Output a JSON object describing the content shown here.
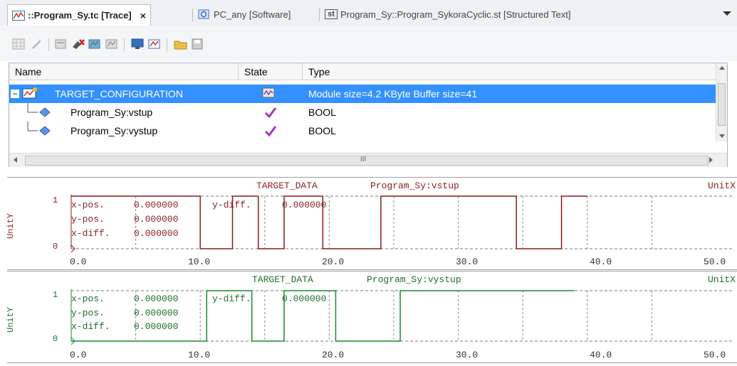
{
  "tabs": [
    {
      "label": "::Program_Sy.tc [Trace]",
      "icon": "trace-icon",
      "close": "×"
    },
    {
      "label": "PC_any [Software]",
      "icon": "software-icon"
    },
    {
      "label": "Program_Sy::Program_SykoraCyclic.st [Structured Text]",
      "icon": "st-icon",
      "badge": "st"
    }
  ],
  "tree": {
    "headers": [
      "Name",
      "State",
      "Type"
    ],
    "rows": [
      {
        "name": "TARGET_CONFIGURATION",
        "type": "Module size=4.2 KByte   Buffer size=41",
        "selected": true,
        "state_icon": "trace-state-icon",
        "expand": "−"
      },
      {
        "name": "Program_Sy:vstup",
        "type": "BOOL",
        "state_icon": "check-icon"
      },
      {
        "name": "Program_Sy:vystup",
        "type": "BOOL",
        "state_icon": "check-icon"
      }
    ],
    "scroll_mid": "III"
  },
  "traces": [
    {
      "source": "TARGET_DATA",
      "variable": "Program_Sy:vstup",
      "unitx": "UnitX",
      "unity": "UnitY",
      "color": "#8b1a1a",
      "xpos_label": "x-pos.",
      "xpos": "0.000000",
      "ypos_label": "y-pos.",
      "ypos": "0.000000",
      "xdiff_label": "x-diff.",
      "xdiff": "0.000000",
      "ydiff_label": "y-diff.",
      "ydiff": "0.000000",
      "y_top": "1",
      "y_bot": "0",
      "ticks": [
        "0.0",
        "10.0",
        "20.0",
        "30.0",
        "40.0",
        "50.0"
      ]
    },
    {
      "source": "TARGET_DATA",
      "variable": "Program_Sy:vystup",
      "unitx": "UnitX",
      "unity": "UnitY",
      "color": "#1a8a2a",
      "xpos_label": "x-pos.",
      "xpos": "0.000000",
      "ypos_label": "y-pos.",
      "ypos": "0.000000",
      "xdiff_label": "x-diff.",
      "xdiff": "0.000000",
      "ydiff_label": "y-diff.",
      "ydiff": "0.000000",
      "y_top": "1",
      "y_bot": "0",
      "ticks": [
        "0.0",
        "10.0",
        "20.0",
        "30.0",
        "40.0",
        "50.0"
      ]
    }
  ],
  "chart_data": [
    {
      "type": "line",
      "title": "TARGET_DATA  Program_Sy:vstup",
      "xlabel": "UnitX",
      "ylabel": "UnitY",
      "xlim": [
        0,
        50
      ],
      "ylim": [
        0,
        1
      ],
      "series": [
        {
          "name": "Program_Sy:vstup",
          "x": [
            0,
            10,
            10,
            12.5,
            12.5,
            14.5,
            14.5,
            16.5,
            16.5,
            19.5,
            19.5,
            24,
            24,
            34.5,
            34.5,
            38,
            38,
            40
          ],
          "y": [
            1,
            1,
            0,
            0,
            1,
            1,
            0,
            0,
            1,
            1,
            0,
            0,
            1,
            1,
            0,
            0,
            1,
            1
          ]
        }
      ]
    },
    {
      "type": "line",
      "title": "TARGET_DATA  Program_Sy:vystup",
      "xlabel": "UnitX",
      "ylabel": "UnitY",
      "xlim": [
        0,
        50
      ],
      "ylim": [
        0,
        1
      ],
      "series": [
        {
          "name": "Program_Sy:vystup",
          "x": [
            0,
            10.5,
            10.5,
            14,
            14,
            16.5,
            16.5,
            20.5,
            20.5,
            25.5,
            25.5,
            39
          ],
          "y": [
            0,
            0,
            1,
            1,
            0,
            0,
            1,
            1,
            0,
            0,
            1,
            1
          ]
        }
      ]
    }
  ]
}
